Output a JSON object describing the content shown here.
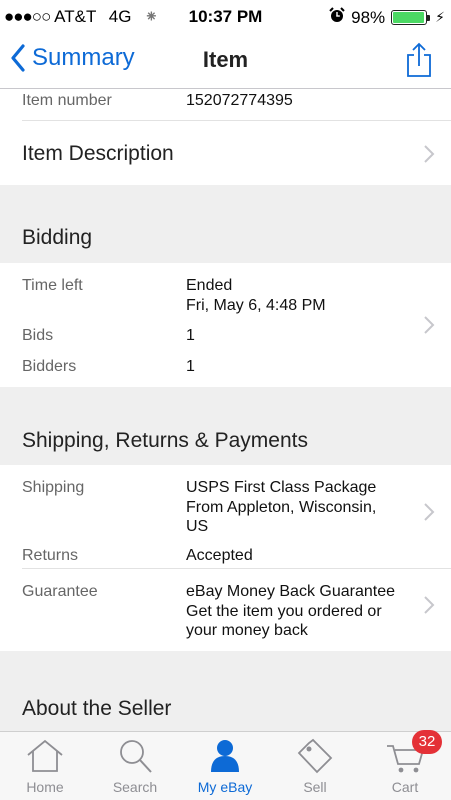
{
  "status_bar": {
    "signal_dots": "●●●○○",
    "carrier": "AT&T",
    "network": "4G",
    "time": "10:37 PM",
    "battery_percent": "98%",
    "battery_level": 0.98
  },
  "nav": {
    "back_label": "Summary",
    "title": "Item"
  },
  "item_number": {
    "label": "Item number",
    "value": "152072774395"
  },
  "item_description": {
    "label": "Item Description"
  },
  "bidding": {
    "title": "Bidding",
    "time_left_label": "Time left",
    "time_left_value": "Ended",
    "time_left_date": "Fri, May 6, 4:48 PM",
    "bids_label": "Bids",
    "bids_value": "1",
    "bidders_label": "Bidders",
    "bidders_value": "1"
  },
  "shipping": {
    "title": "Shipping, Returns & Payments",
    "shipping_label": "Shipping",
    "shipping_value": "USPS First Class Package",
    "shipping_from_line1": "From Appleton, Wisconsin,",
    "shipping_from_line2": "US",
    "returns_label": "Returns",
    "returns_value": "Accepted",
    "guarantee_label": "Guarantee",
    "guarantee_value": "eBay Money Back Guarantee",
    "guarantee_sub_line1": "Get the item you ordered or",
    "guarantee_sub_line2": "your money back"
  },
  "seller": {
    "title": "About the Seller"
  },
  "tabs": {
    "home": "Home",
    "search": "Search",
    "my_ebay": "My eBay",
    "sell": "Sell",
    "cart": "Cart",
    "cart_badge": "32"
  },
  "colors": {
    "accent": "#0d6ad6",
    "section_bg": "#efefef",
    "badge": "#e43137",
    "battery": "#4cd964"
  }
}
